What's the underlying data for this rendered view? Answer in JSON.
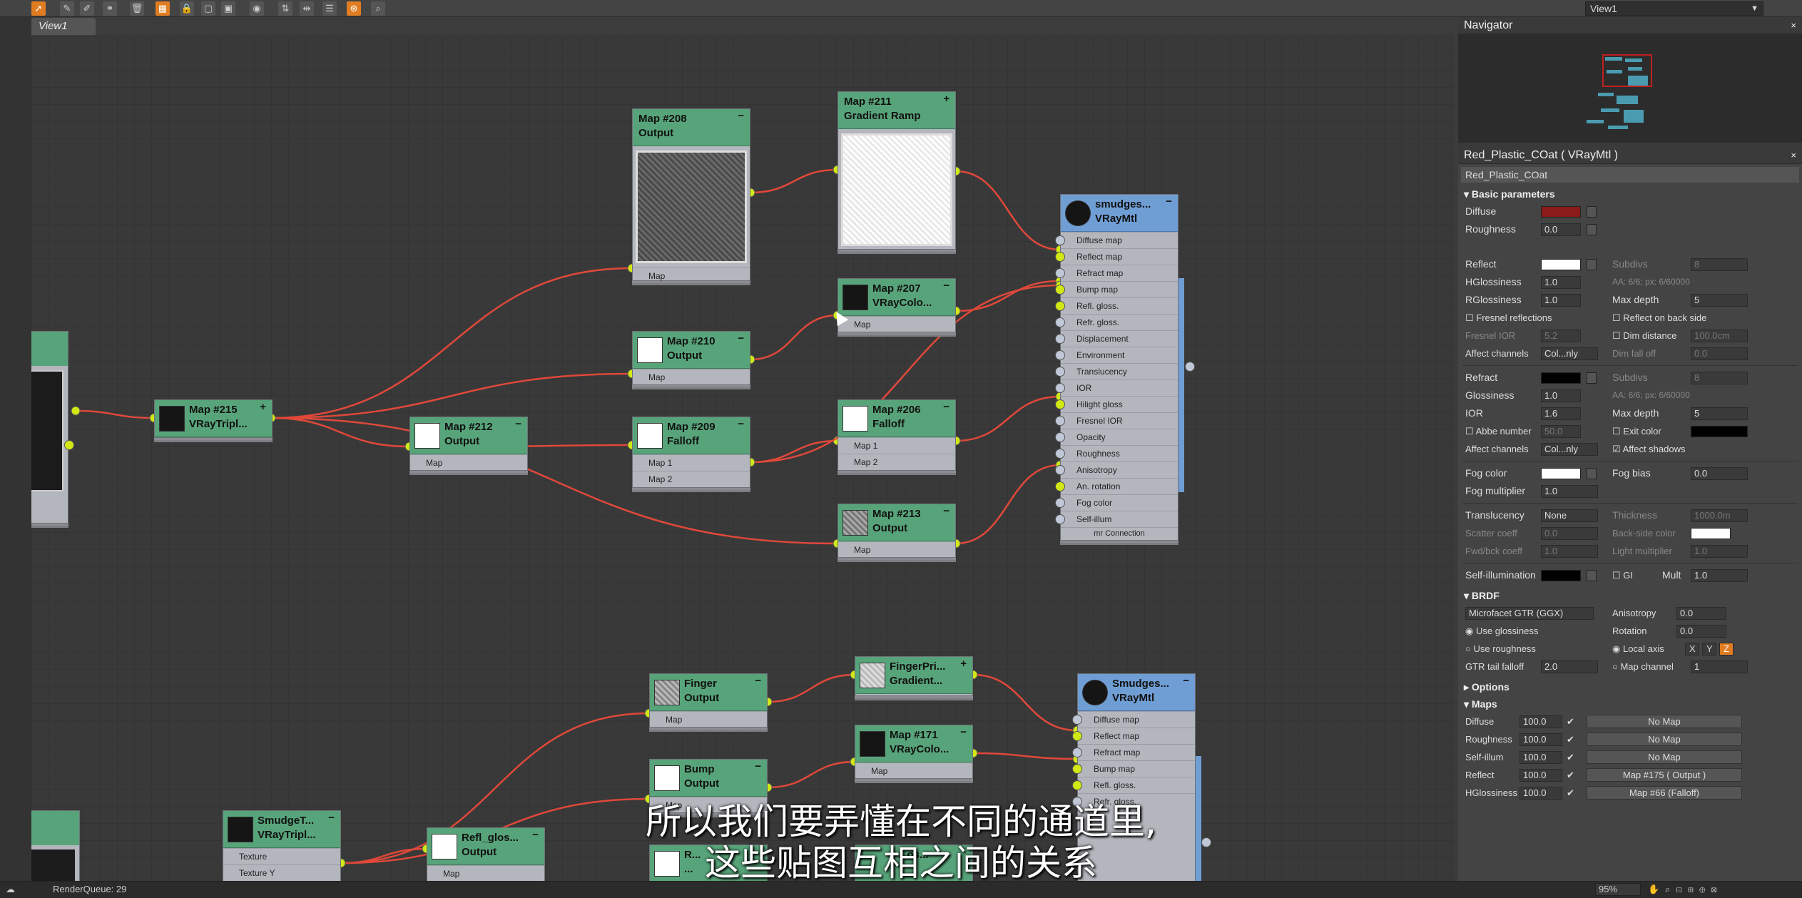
{
  "toolbar": {
    "tools": [
      "select-icon",
      "pencil-icon",
      "brush-icon",
      "link-icon",
      "trash-icon",
      "layout-icon",
      "lock-icon",
      "frame-icon",
      "hide-icon",
      "material-icon",
      "align-icon",
      "arrange-icon",
      "list-icon",
      "render-icon",
      "search-icon"
    ],
    "active_tools": [
      "select-icon",
      "layout-icon",
      "render-icon"
    ],
    "view_dropdown": "View1"
  },
  "view_tab": "View1",
  "nodes": {
    "n208": {
      "title": "Map #208",
      "subtitle": "Output",
      "slot": "Map"
    },
    "n211": {
      "title": "Map #211",
      "subtitle": "Gradient Ramp"
    },
    "n207": {
      "title": "Map #207",
      "subtitle": "VRayColo...",
      "slot": "Map"
    },
    "n210": {
      "title": "Map #210",
      "subtitle": "Output",
      "slot": "Map"
    },
    "n215": {
      "title": "Map #215",
      "subtitle": "VRayTripl..."
    },
    "n212": {
      "title": "Map #212",
      "subtitle": "Output",
      "slot": "Map"
    },
    "n209": {
      "title": "Map #209",
      "subtitle": "Falloff",
      "slot1": "Map 1",
      "slot2": "Map 2"
    },
    "n206": {
      "title": "Map #206",
      "subtitle": "Falloff",
      "slot1": "Map 1",
      "slot2": "Map 2"
    },
    "n213": {
      "title": "Map #213",
      "subtitle": "Output",
      "slot": "Map"
    },
    "vray1": {
      "title": "smudges...",
      "subtitle": "VRayMtl",
      "slots": [
        "Diffuse map",
        "Reflect map",
        "Refract map",
        "Bump map",
        "Refl. gloss.",
        "Refr. gloss.",
        "Displacement",
        "Environment",
        "Translucency",
        "IOR",
        "Hilight gloss",
        "Fresnel IOR",
        "Opacity",
        "Roughness",
        "Anisotropy",
        "An. rotation",
        "Fog color",
        "Self-illum"
      ],
      "footer": "mr Connection"
    },
    "finger": {
      "title": "Finger",
      "subtitle": "Output",
      "slot": "Map"
    },
    "fingerpri": {
      "title": "FingerPri...",
      "subtitle": "Gradient..."
    },
    "bump": {
      "title": "Bump",
      "subtitle": "Output",
      "slot": "Map"
    },
    "n171": {
      "title": "Map #171",
      "subtitle": "VRayColo...",
      "slot": "Map"
    },
    "vray2": {
      "title": "Smudges...",
      "subtitle": "VRayMtl",
      "slots": [
        "Diffuse map",
        "Reflect map",
        "Refract map",
        "Bump map",
        "Refl. gloss.",
        "Refr. gloss."
      ]
    },
    "smudget": {
      "title": "SmudgeT...",
      "subtitle": "VRayTripl...",
      "slot1": "Texture",
      "slot2": "Texture Y"
    },
    "reflglos": {
      "title": "Refl_glos...",
      "subtitle": "Output",
      "slot": "Map"
    },
    "partial": {
      "title": "R...",
      "subtitle": "..."
    },
    "partial2": {
      "title": "...os..."
    }
  },
  "navigator": {
    "title": "Navigator"
  },
  "material": {
    "header": "Red_Plastic_COat  ( VRayMtl )",
    "name": "Red_Plastic_COat",
    "basic": "Basic parameters",
    "diffuse_label": "Diffuse",
    "diffuse_color": "#8b1a1a",
    "roughness_label": "Roughness",
    "roughness": "0.0",
    "reflect_label": "Reflect",
    "subdivs_label": "Subdivs",
    "subdivs": "8",
    "hgloss_label": "HGlossiness",
    "hgloss": "1.0",
    "aa_text": "AA: 6/6; px: 6/60000",
    "rgloss_label": "RGlossiness",
    "rgloss": "1.0",
    "maxdepth_label": "Max depth",
    "maxdepth": "5",
    "fresnel_label": "Fresnel reflections",
    "reflect_back_label": "Reflect on back side",
    "fresnel_ior_label": "Fresnel IOR",
    "fresnel_ior": "5.2",
    "dim_dist_label": "Dim distance",
    "dim_dist": "100.0cm",
    "affect_label": "Affect channels",
    "affect_val": "Col...nly",
    "dim_falloff_label": "Dim fall off",
    "dim_falloff": "0.0",
    "refract_label": "Refract",
    "refr_subdivs": "8",
    "gloss_label": "Glossiness",
    "gloss": "1.0",
    "aa_text2": "AA: 6/6; px: 6/60000",
    "ior_label": "IOR",
    "ior": "1.6",
    "maxdepth2": "5",
    "abbe_label": "Abbe number",
    "abbe": "50.0",
    "exit_color_label": "Exit color",
    "affect_val2": "Col...nly",
    "affect_shadows_label": "Affect shadows",
    "fog_color_label": "Fog color",
    "fog_bias_label": "Fog bias",
    "fog_bias": "0.0",
    "fog_mult_label": "Fog multiplier",
    "fog_mult": "1.0",
    "transl_label": "Translucency",
    "transl_val": "None",
    "thickness_label": "Thickness",
    "thickness": "1000.0m",
    "scatter_label": "Scatter coeff",
    "scatter": "0.0",
    "backside_label": "Back-side color",
    "fwd_label": "Fwd/bck coeff",
    "fwd": "1.0",
    "light_mult_label": "Light multiplier",
    "light_mult": "1.0",
    "selfillum_label": "Self-illumination",
    "gi_label": "GI",
    "mult_label": "Mult",
    "mult": "1.0",
    "brdf": "BRDF",
    "brdf_type": "Microfacet GTR (GGX)",
    "aniso_label": "Anisotropy",
    "aniso": "0.0",
    "use_gloss_label": "Use glossiness",
    "rotation_label": "Rotation",
    "rotation": "0.0",
    "use_rough_label": "Use roughness",
    "local_axis_label": "Local axis",
    "axis_x": "X",
    "axis_y": "Y",
    "axis_z": "Z",
    "gtr_label": "GTR tail falloff",
    "gtr": "2.0",
    "map_channel_label": "Map channel",
    "map_channel": "1",
    "options": "Options",
    "maps": "Maps",
    "map_rows": [
      {
        "label": "Diffuse",
        "amount": "100.0",
        "map": "No Map"
      },
      {
        "label": "Roughness",
        "amount": "100.0",
        "map": "No Map"
      },
      {
        "label": "Self-illum",
        "amount": "100.0",
        "map": "No Map"
      },
      {
        "label": "Reflect",
        "amount": "100.0",
        "map": "Map #175  ( Output )"
      },
      {
        "label": "HGlossiness",
        "amount": "100.0",
        "map": "Map #66  (Falloff)"
      }
    ]
  },
  "subtitle": {
    "line1": "所以我们要弄懂在不同的通道里,",
    "line2": "这些贴图互相之间的关系"
  },
  "status": {
    "render_queue": "RenderQueue: 29",
    "zoom": "95%"
  }
}
